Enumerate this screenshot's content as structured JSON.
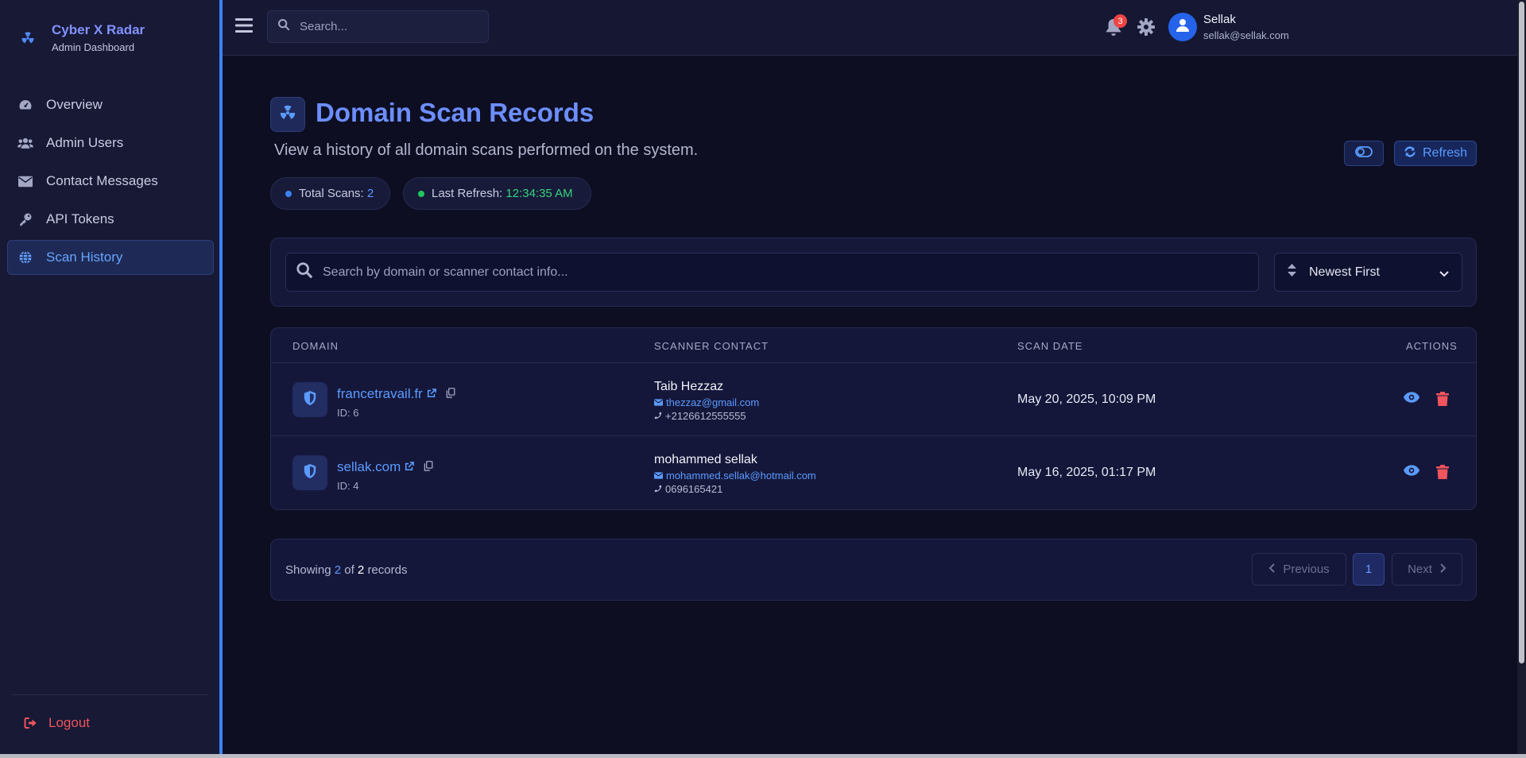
{
  "brand": {
    "title": "Cyber X Radar",
    "subtitle": "Admin Dashboard"
  },
  "sidebar": {
    "items": [
      {
        "label": "Overview",
        "icon": "gauge-icon",
        "active": false
      },
      {
        "label": "Admin Users",
        "icon": "users-icon",
        "active": false
      },
      {
        "label": "Contact Messages",
        "icon": "envelope-icon",
        "active": false
      },
      {
        "label": "API Tokens",
        "icon": "key-icon",
        "active": false
      },
      {
        "label": "Scan History",
        "icon": "globe-icon",
        "active": true
      }
    ],
    "logout_label": "Logout"
  },
  "topbar": {
    "search_placeholder": "Search...",
    "notification_count": "3",
    "user": {
      "name": "Sellak",
      "email": "sellak@sellak.com"
    }
  },
  "page": {
    "title": "Domain Scan Records",
    "subtitle": "View a history of all domain scans performed on the system.",
    "refresh_label": "Refresh",
    "stats": {
      "total_label": "Total Scans:",
      "total_value": "2",
      "last_refresh_label": "Last Refresh:",
      "last_refresh_value": "12:34:35 AM"
    }
  },
  "filters": {
    "search_placeholder": "Search by domain or scanner contact info...",
    "sort_value": "Newest First"
  },
  "table": {
    "headers": {
      "domain": "DOMAIN",
      "contact": "SCANNER CONTACT",
      "date": "SCAN DATE",
      "actions": "ACTIONS"
    },
    "rows": [
      {
        "domain": "francetravail.fr",
        "id": "ID: 6",
        "name": "Taib Hezzaz",
        "email": "thezzaz@gmail.com",
        "phone": "+2126612555555",
        "date": "May 20, 2025, 10:09 PM"
      },
      {
        "domain": "sellak.com",
        "id": "ID: 4",
        "name": "mohammed sellak",
        "email": "mohammed.sellak@hotmail.com",
        "phone": "0696165421",
        "date": "May 16, 2025, 01:17 PM"
      }
    ]
  },
  "pagination": {
    "showing_prefix": "Showing",
    "showing_count": "2",
    "showing_of": "of",
    "showing_total": "2",
    "showing_suffix": "records",
    "prev_label": "Previous",
    "current_page": "1",
    "next_label": "Next"
  },
  "colors": {
    "accent": "#5b9bff",
    "title": "#6d8eff",
    "danger": "#ef4444",
    "success": "#22c55e"
  }
}
